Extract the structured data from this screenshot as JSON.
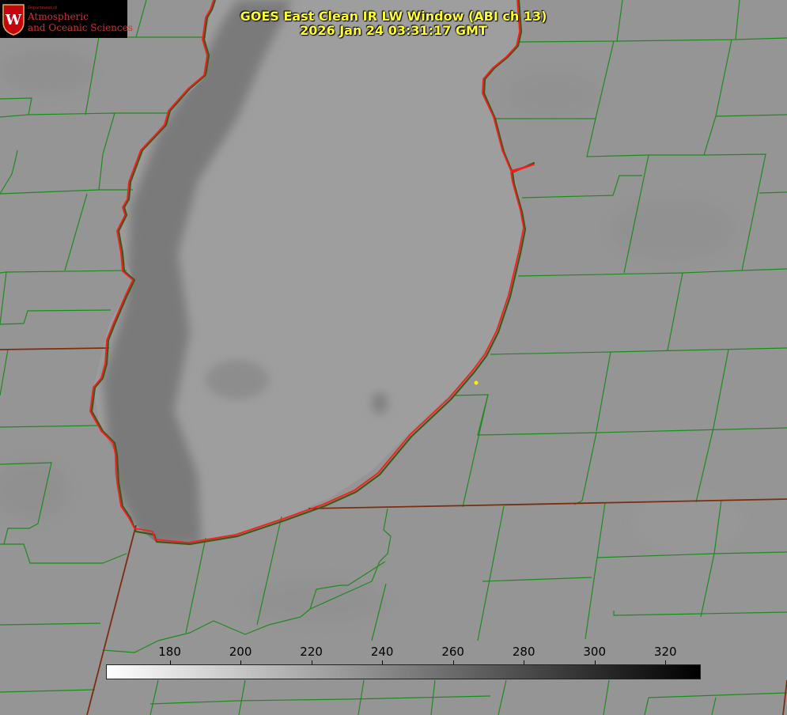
{
  "title": {
    "line1": "GOES East Clean IR LW Window (ABI ch 13)",
    "line2": "2026 Jan 24 03:31:17 GMT"
  },
  "logo": {
    "dept": "Department of",
    "line1": "Atmospheric",
    "line2": "and Oceanic Sciences",
    "letter": "W"
  },
  "colorbar": {
    "ticks": [
      "180",
      "200",
      "220",
      "240",
      "260",
      "280",
      "300",
      "320"
    ],
    "range": [
      162,
      330
    ],
    "colors": {
      "low": "#ffffff",
      "high": "#000000"
    }
  },
  "colors": {
    "land": "#959595",
    "lake": "#9e9e9e",
    "lake_cold_band": "#7a7a7a",
    "county_lines": "#1f8a1f",
    "state_lines": "#7a2e10",
    "coastline": "#ff1a1a",
    "title": "#ffff33",
    "marker": "#ffee00"
  },
  "icons": {
    "logo": "uw-crest-icon",
    "marker": "location-marker-icon"
  }
}
